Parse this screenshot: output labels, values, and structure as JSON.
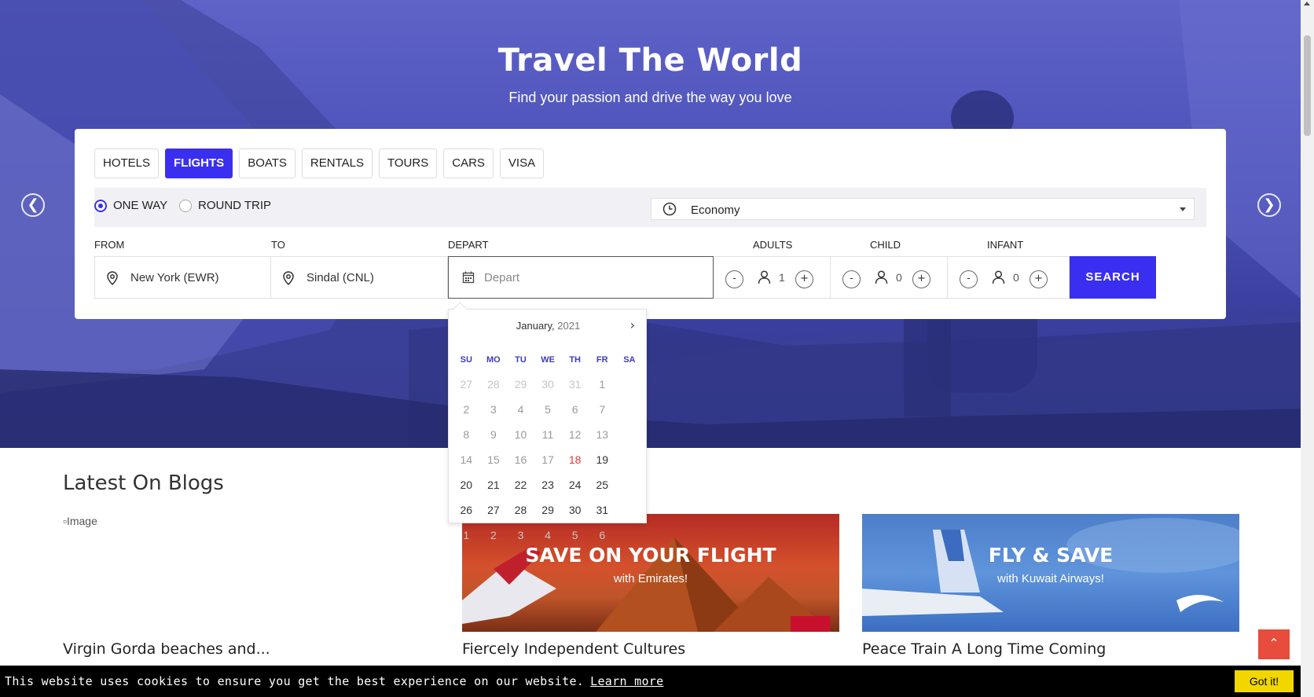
{
  "hero": {
    "title": "Travel The World",
    "subtitle": "Find your passion and drive the way you love",
    "prev_arrow": "❮",
    "next_arrow": "❯"
  },
  "tabs": [
    {
      "label": "HOTELS",
      "active": false
    },
    {
      "label": "FLIGHTS",
      "active": true
    },
    {
      "label": "BOATS",
      "active": false
    },
    {
      "label": "RENTALS",
      "active": false
    },
    {
      "label": "TOURS",
      "active": false
    },
    {
      "label": "CARS",
      "active": false
    },
    {
      "label": "VISA",
      "active": false
    }
  ],
  "trip": {
    "one_way": "ONE WAY",
    "round_trip": "ROUND TRIP",
    "selected": "one_way",
    "cabin_class": "Economy"
  },
  "search": {
    "from_label": "FROM",
    "from_value": "New York (EWR)",
    "to_label": "TO",
    "to_value": "Sindal (CNL)",
    "depart_label": "DEPART",
    "depart_placeholder": "Depart",
    "adults_label": "ADULTS",
    "adults": "1",
    "child_label": "CHILD",
    "child": "0",
    "infant_label": "INFANT",
    "infant": "0",
    "minus": "-",
    "plus": "+",
    "button": "SEARCH"
  },
  "calendar": {
    "month": "January,",
    "year": "2021",
    "next": "›",
    "weekdays": [
      "SU",
      "MO",
      "TU",
      "WE",
      "TH",
      "FR",
      "SA"
    ],
    "days": [
      {
        "d": "27",
        "s": "muted"
      },
      {
        "d": "28",
        "s": "muted"
      },
      {
        "d": "29",
        "s": "muted"
      },
      {
        "d": "30",
        "s": "muted"
      },
      {
        "d": "31",
        "s": "muted"
      },
      {
        "d": "1",
        "s": "past"
      },
      {
        "d": "2",
        "s": "past"
      },
      {
        "d": "3",
        "s": "past"
      },
      {
        "d": "4",
        "s": "past"
      },
      {
        "d": "5",
        "s": "past"
      },
      {
        "d": "6",
        "s": "past"
      },
      {
        "d": "7",
        "s": "past"
      },
      {
        "d": "8",
        "s": "past"
      },
      {
        "d": "9",
        "s": "past"
      },
      {
        "d": "10",
        "s": "past"
      },
      {
        "d": "11",
        "s": "past"
      },
      {
        "d": "12",
        "s": "past"
      },
      {
        "d": "13",
        "s": "past"
      },
      {
        "d": "14",
        "s": "past"
      },
      {
        "d": "15",
        "s": "past"
      },
      {
        "d": "16",
        "s": "past"
      },
      {
        "d": "17",
        "s": "past"
      },
      {
        "d": "18",
        "s": "today"
      },
      {
        "d": "19",
        "s": ""
      },
      {
        "d": "20",
        "s": ""
      },
      {
        "d": "21",
        "s": ""
      },
      {
        "d": "22",
        "s": ""
      },
      {
        "d": "23",
        "s": ""
      },
      {
        "d": "24",
        "s": ""
      },
      {
        "d": "25",
        "s": ""
      },
      {
        "d": "26",
        "s": ""
      },
      {
        "d": "27",
        "s": ""
      },
      {
        "d": "28",
        "s": ""
      },
      {
        "d": "29",
        "s": ""
      },
      {
        "d": "30",
        "s": ""
      },
      {
        "d": "31",
        "s": ""
      },
      {
        "d": "1",
        "s": "muted"
      },
      {
        "d": "2",
        "s": "muted"
      },
      {
        "d": "3",
        "s": "muted"
      },
      {
        "d": "4",
        "s": "muted"
      },
      {
        "d": "5",
        "s": "muted"
      },
      {
        "d": "6",
        "s": "muted"
      }
    ]
  },
  "blogs": {
    "title": "Latest On Blogs",
    "broken_image_alt": "Image",
    "posts": [
      {
        "title": "Virgin Gorda beaches and..."
      },
      {
        "title": "Fiercely Independent Cultures",
        "banner_head": "SAVE ON YOUR FLIGHT",
        "banner_sub": "with Emirates!"
      },
      {
        "title": "Peace Train A Long Time Coming",
        "banner_head": "FLY & SAVE",
        "banner_sub": "with Kuwait Airways!"
      }
    ]
  },
  "back_to_top": "⌃",
  "cookie": {
    "message": "This website uses cookies to ensure you get the best experience on our website.",
    "link": "Learn more",
    "button": "Got it!"
  },
  "colors": {
    "accent": "#3a2ff0",
    "today": "#e53935",
    "cookie_button": "#f1d600",
    "back_to_top": "#e74c3c"
  }
}
